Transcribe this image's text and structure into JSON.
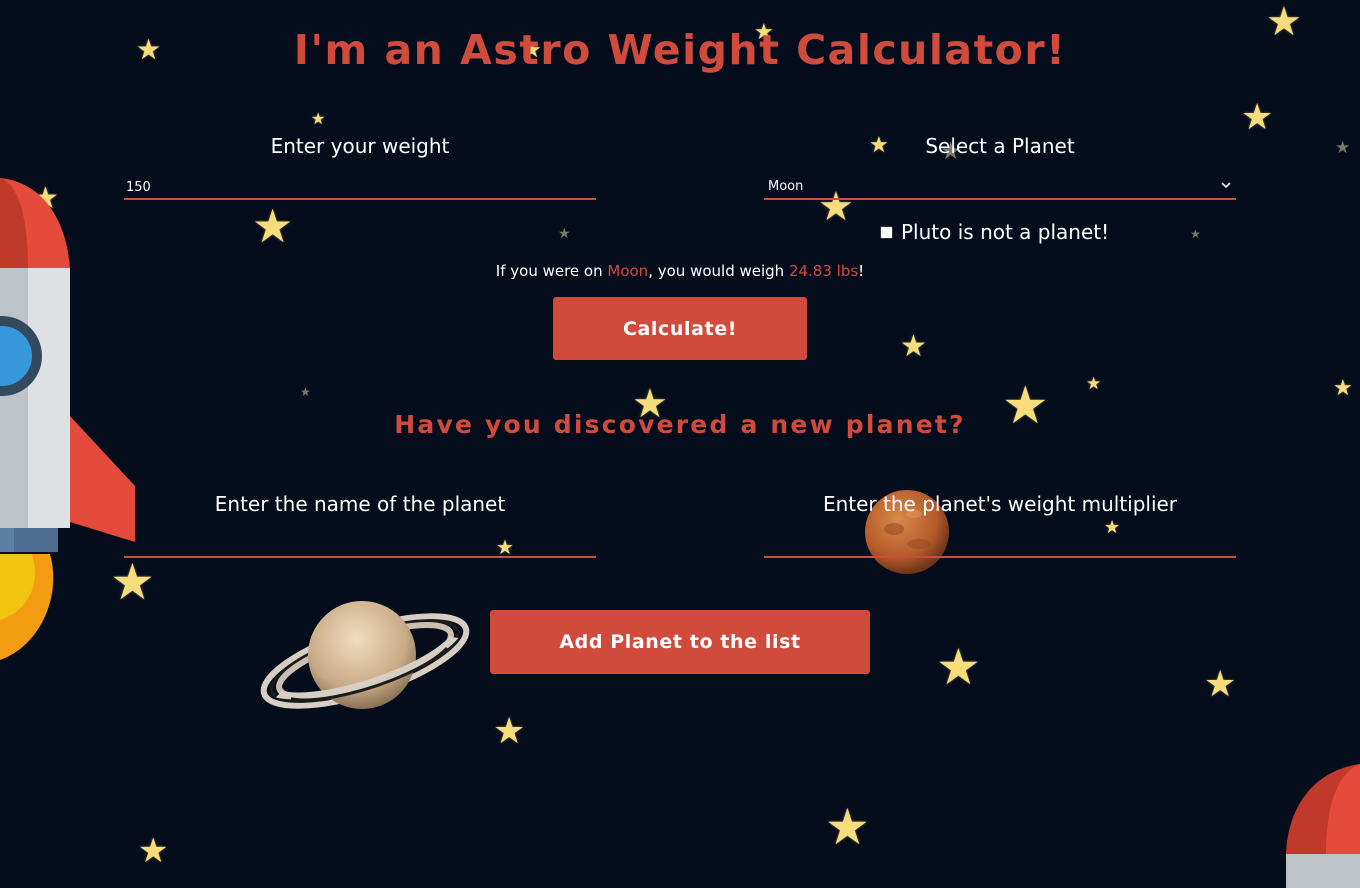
{
  "colors": {
    "background": "#050d1d",
    "accent": "#d14b3d",
    "text": "#ffffff",
    "star": "#f6dc7a"
  },
  "page": {
    "title": "I'm an Astro Weight Calculator!"
  },
  "weight_form": {
    "weight_label": "Enter your weight",
    "weight_value": "150",
    "planet_label": "Select a Planet",
    "planet_selected": "Moon",
    "pluto_checkbox_label": "Pluto is not a planet!",
    "pluto_checked": false
  },
  "result": {
    "prefix": "If you were on ",
    "planet": "Moon",
    "middle": ", you would weigh ",
    "weight": "24.83 lbs",
    "suffix": "!"
  },
  "calculate_button": {
    "label": "Calculate!"
  },
  "new_planet": {
    "heading": "Have you discovered a new planet?",
    "name_label": "Enter the name of the planet",
    "name_value": "",
    "multiplier_label": "Enter the planet's weight multiplier",
    "multiplier_value": "",
    "add_button_label": "Add Planet to the list"
  },
  "decorations": {
    "rocket_image": "rocket-illustration",
    "saturn_image": "saturn-illustration",
    "mars_image": "mars-illustration",
    "star_icon": "star-icon"
  }
}
